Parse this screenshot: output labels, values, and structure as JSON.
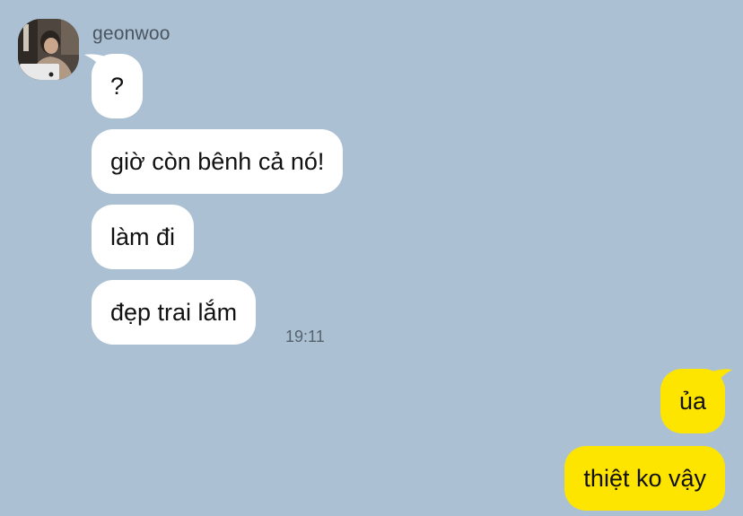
{
  "conversation": {
    "sender_name": "geonwoo",
    "incoming": [
      {
        "text": "?"
      },
      {
        "text": "giờ còn bênh cả nó!"
      },
      {
        "text": "làm đi"
      },
      {
        "text": "đẹp trai lắm"
      }
    ],
    "incoming_time": "19:11",
    "outgoing": [
      {
        "text": "ủa"
      },
      {
        "text": "thiệt ko vậy"
      }
    ]
  },
  "colors": {
    "background": "#abc1d3",
    "incoming_bubble": "#ffffff",
    "outgoing_bubble": "#fee500"
  }
}
